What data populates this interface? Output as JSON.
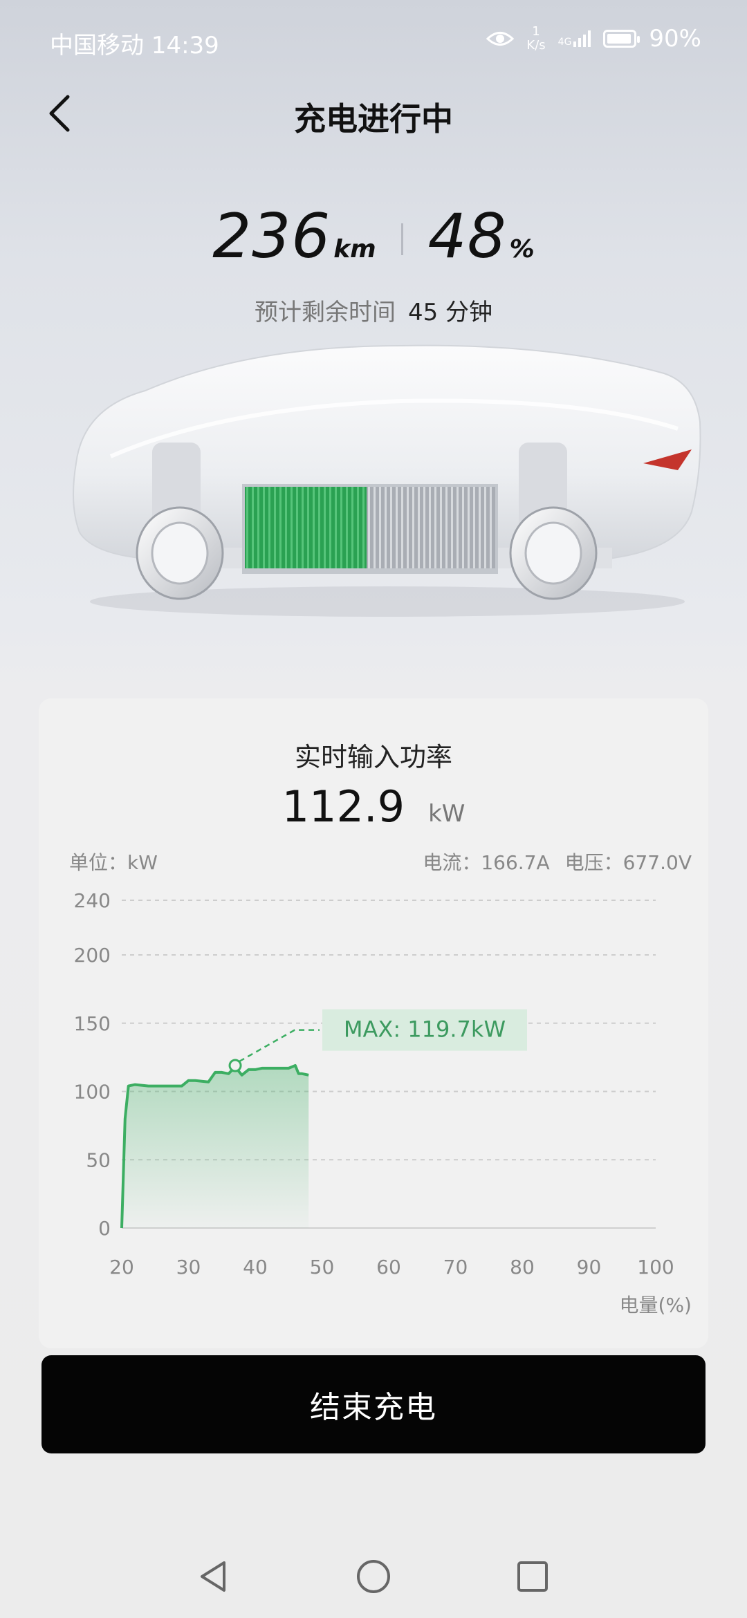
{
  "status_bar": {
    "carrier_time": "中国移动 14:39",
    "speed_value": "1",
    "speed_unit": "K/s",
    "network": "4G",
    "battery": "90%",
    "battery_level": 0.9
  },
  "header": {
    "title": "充电进行中"
  },
  "stats": {
    "range_value": "236",
    "range_unit": "km",
    "soc_value": "48",
    "soc_unit": "%"
  },
  "eta": {
    "label": "预计剩余时间",
    "value": "45 分钟"
  },
  "card": {
    "title": "实时输入功率",
    "power_value": "112.9",
    "power_unit": "kW",
    "unit_label": "单位：kW",
    "current": "电流：166.7A",
    "voltage": "电压：677.0V",
    "x_axis_label": "电量(%)"
  },
  "chart_data": {
    "type": "area",
    "title": "实时输入功率",
    "xlabel": "电量(%)",
    "ylabel": "单位：kW",
    "xlim": [
      20,
      100
    ],
    "ylim": [
      0,
      240
    ],
    "x_ticks": [
      "20",
      "30",
      "40",
      "50",
      "60",
      "70",
      "80",
      "90",
      "100"
    ],
    "y_ticks": [
      "0",
      "50",
      "100",
      "150",
      "200",
      "240"
    ],
    "grid": true,
    "series": [
      {
        "x": [
          20,
          20.5,
          21,
          22,
          24,
          26,
          28,
          29,
          30,
          31,
          33,
          34,
          35,
          36,
          37,
          38,
          39,
          40,
          41,
          42,
          43,
          44,
          45,
          46,
          46.5,
          47,
          48
        ],
        "values": [
          0,
          80,
          104,
          105,
          104,
          104,
          104,
          104,
          108,
          108,
          107,
          114,
          114,
          113,
          118,
          112,
          116,
          116,
          117,
          117,
          117,
          117,
          117,
          119,
          113,
          113,
          112
        ]
      }
    ],
    "annotation": "MAX: 119.7kW",
    "accent_color": "#3cae62"
  },
  "actions": {
    "end_label": "结束充电"
  }
}
